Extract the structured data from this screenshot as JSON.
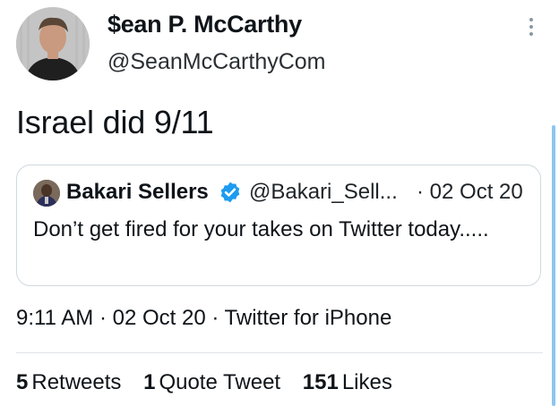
{
  "author": {
    "name": "$ean P. McCarthy",
    "handle": "@SeanMcCarthyCom",
    "avatar_icon": "person-avatar"
  },
  "tweet": {
    "text": "Israel did 9/11",
    "timestamp": "9:11 AM · 02 Oct 20 · Twitter for iPhone"
  },
  "quoted_tweet": {
    "name": "Bakari Sellers",
    "verified": true,
    "verified_color": "#1d9bf0",
    "handle": "@Bakari_Sell...",
    "date": "· 02 Oct 20",
    "text": "Don’t get fired for your takes on Twitter today....."
  },
  "stats": {
    "retweets_count": "5",
    "retweets_label": "Retweets",
    "quotes_count": "1",
    "quotes_label": "Quote Tweet",
    "likes_count": "151",
    "likes_label": "Likes"
  },
  "icons": {
    "more": "more-vertical-icon",
    "verified": "verified-badge-icon"
  }
}
